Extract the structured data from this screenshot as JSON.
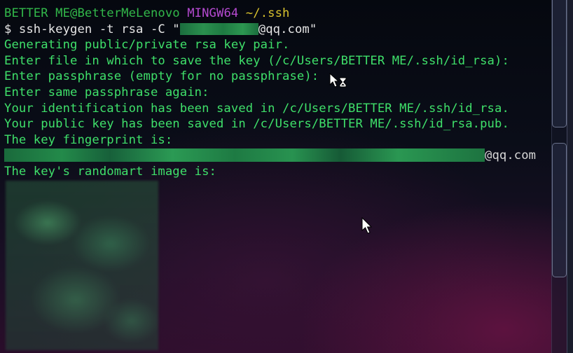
{
  "terminal": {
    "prompt": {
      "user_host": "BETTER ME@BetterMeLenovo",
      "env": "MINGW64",
      "path": "~/.ssh"
    },
    "command": {
      "prefix": "$ ssh-keygen -t rsa -C \"",
      "suffix": "@qq.com\""
    },
    "output_lines": [
      "Generating public/private rsa key pair.",
      "Enter file in which to save the key (/c/Users/BETTER ME/.ssh/id_rsa):",
      "Enter passphrase (empty for no passphrase):",
      "Enter same passphrase again:",
      "Your identification has been saved in /c/Users/BETTER ME/.ssh/id_rsa.",
      "Your public key has been saved in /c/Users/BETTER ME/.ssh/id_rsa.pub.",
      "The key fingerprint is:"
    ],
    "fingerprint_suffix": "@qq.com",
    "randomart_heading": "The key's randomart image is:"
  },
  "colors": {
    "text_green": "#3fe06a",
    "prompt_env": "#b54ad0",
    "prompt_path": "#d9c22e",
    "command_white": "#e6e6e6"
  },
  "icons": {
    "cursor_busy": "arrow-hourglass-cursor-icon",
    "cursor_arrow": "arrow-cursor-icon"
  }
}
